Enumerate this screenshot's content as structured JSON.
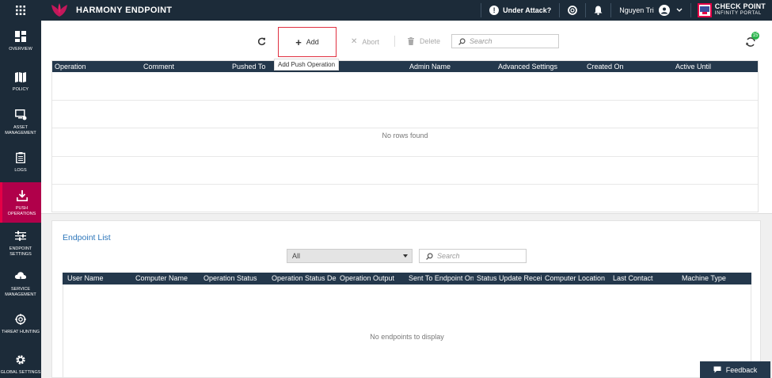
{
  "app": {
    "title": "HARMONY ENDPOINT"
  },
  "topbar": {
    "under_attack": "Under Attack?",
    "user_name": "Nguyen Tri",
    "brand_line1": "CHECK POINT",
    "brand_line2": "INFINITY PORTAL"
  },
  "sidebar": {
    "items": [
      {
        "label": "OVERVIEW",
        "icon": "overview-icon"
      },
      {
        "label": "POLICY",
        "icon": "policy-icon"
      },
      {
        "label": "ASSET MANAGEMENT",
        "icon": "asset-management-icon"
      },
      {
        "label": "LOGS",
        "icon": "logs-icon"
      },
      {
        "label": "PUSH OPERATIONS",
        "icon": "push-operations-icon",
        "active": true
      },
      {
        "label": "ENDPOINT SETTINGS",
        "icon": "endpoint-settings-icon"
      },
      {
        "label": "SERVICE MANAGEMENT",
        "icon": "service-management-icon"
      },
      {
        "label": "THREAT HUNTING",
        "icon": "threat-hunting-icon"
      },
      {
        "label": "GLOBAL SETTINGS",
        "icon": "global-settings-icon"
      }
    ]
  },
  "toolbar": {
    "add_label": "Add",
    "add_tooltip": "Add Push Operation",
    "abort_label": "Abort",
    "delete_label": "Delete",
    "search_placeholder": "Search",
    "notification_count": "15"
  },
  "operations_table": {
    "columns": [
      "Operation",
      "Comment",
      "Pushed To",
      "",
      "Admin Name",
      "Advanced Settings",
      "Created On",
      "Active Until"
    ],
    "empty_message": "No rows found"
  },
  "endpoint_list": {
    "title": "Endpoint List",
    "filter_value": "All",
    "search_placeholder": "Search",
    "columns": [
      "User Name",
      "Computer Name",
      "Operation Status",
      "Operation Status Desc",
      "Operation Output",
      "Sent To Endpoint On",
      "Status Update Receive",
      "Computer Location",
      "Last Contact",
      "Machine Type"
    ],
    "empty_message": "No endpoints to display"
  },
  "feedback": {
    "label": "Feedback"
  },
  "colors": {
    "nav_bg": "#1c2b39",
    "active": "#b0004a",
    "accent": "#e40046",
    "link": "#2e77bb",
    "header_bg": "#24384c"
  }
}
